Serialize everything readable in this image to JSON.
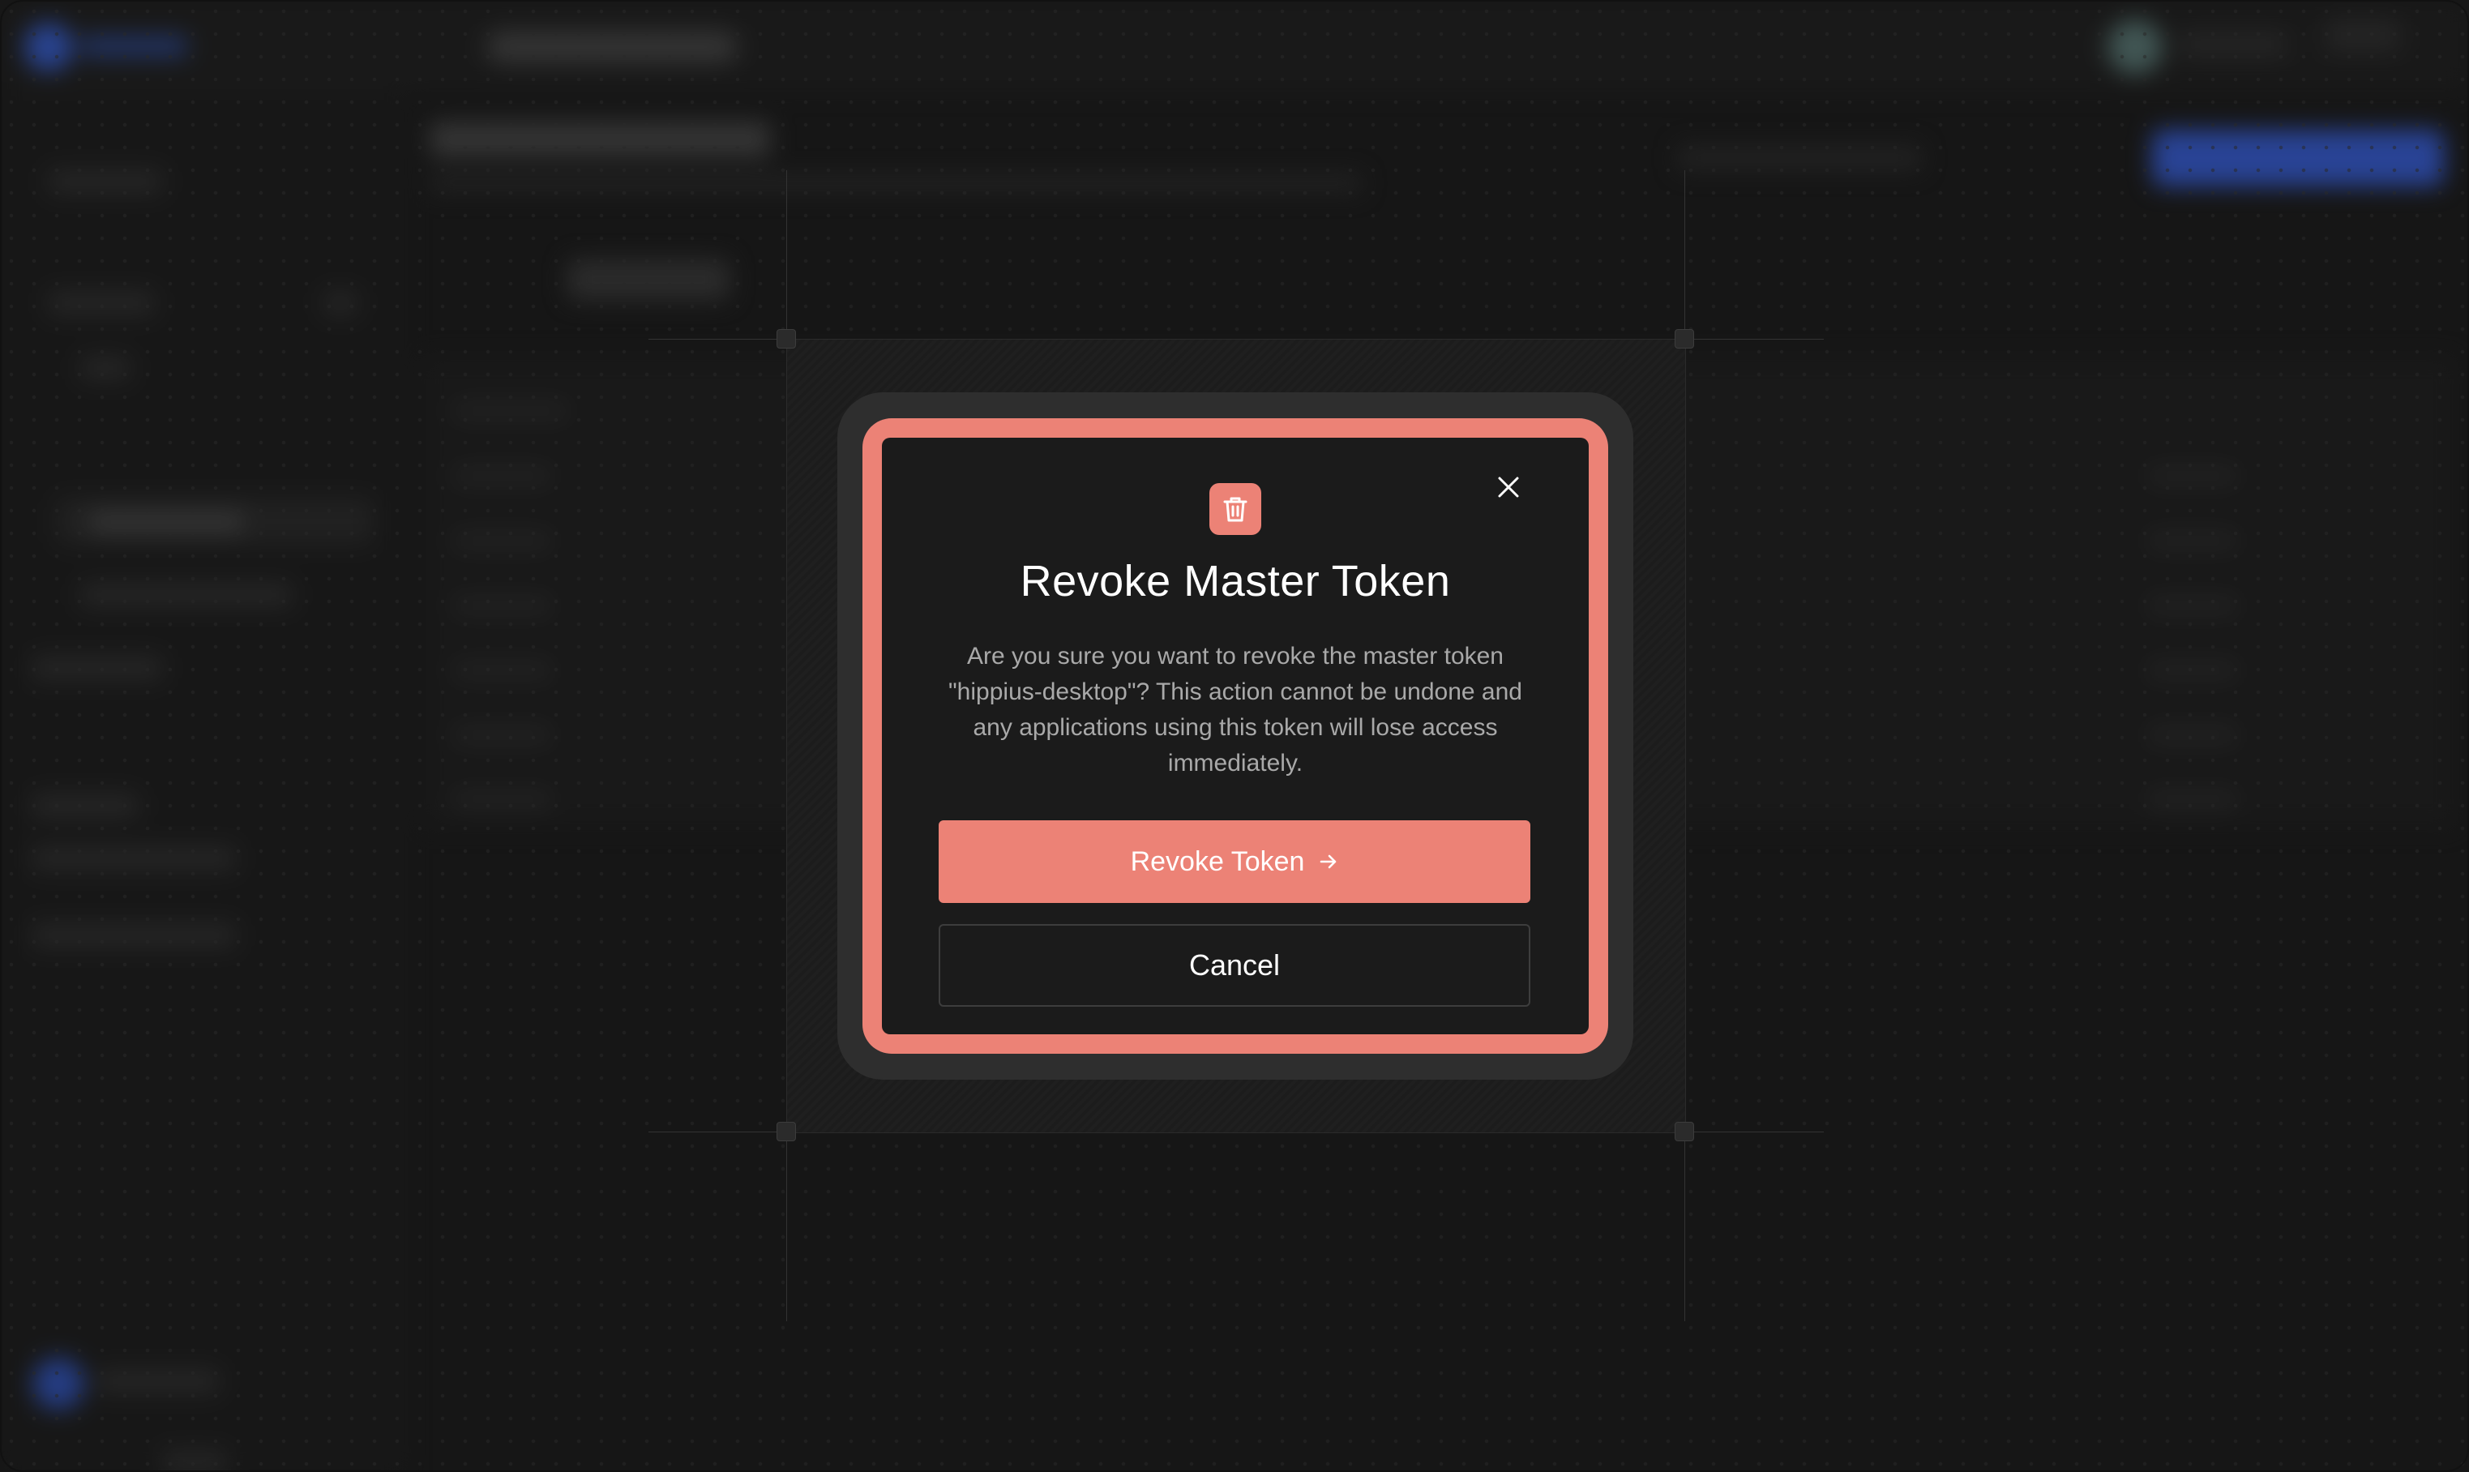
{
  "dialog": {
    "title": "Revoke Master Token",
    "message": "Are you sure you want to revoke the master token \"hippius-desktop\"? This action cannot be undone and any applications using this token will lose access immediately.",
    "confirm_label": "Revoke Token",
    "cancel_label": "Cancel",
    "icon": "trash-icon",
    "close_icon": "close-icon",
    "confirm_icon": "arrow-right-icon"
  },
  "colors": {
    "accent": "#ec8276",
    "dialog_bg": "#1b1b1b",
    "page_bg": "#1e1e1e",
    "primary_blue": "#3b63e0"
  }
}
